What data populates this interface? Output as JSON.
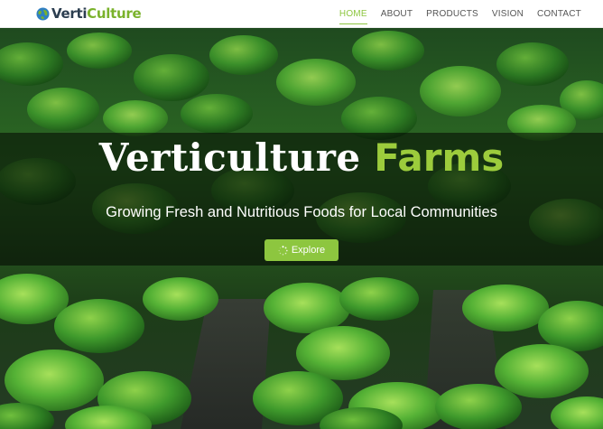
{
  "brand": {
    "part1": "Verti",
    "part2": "Culture"
  },
  "nav": {
    "items": [
      {
        "label": "HOME",
        "active": true
      },
      {
        "label": "ABOUT",
        "active": false
      },
      {
        "label": "PRODUCTS",
        "active": false
      },
      {
        "label": "VISION",
        "active": false
      },
      {
        "label": "CONTACT",
        "active": false
      }
    ]
  },
  "hero": {
    "title_part1": "Verticulture",
    "title_part2": "Farms",
    "subtitle": "Growing Fresh and Nutritious Foods for Local Communities",
    "button_label": "Explore",
    "button_icon": "spinner-icon"
  },
  "colors": {
    "accent": "#8dc63f",
    "brand_dark": "#2c3e50",
    "nav_text": "#555555",
    "overlay": "rgba(0,0,0,0.52)"
  }
}
